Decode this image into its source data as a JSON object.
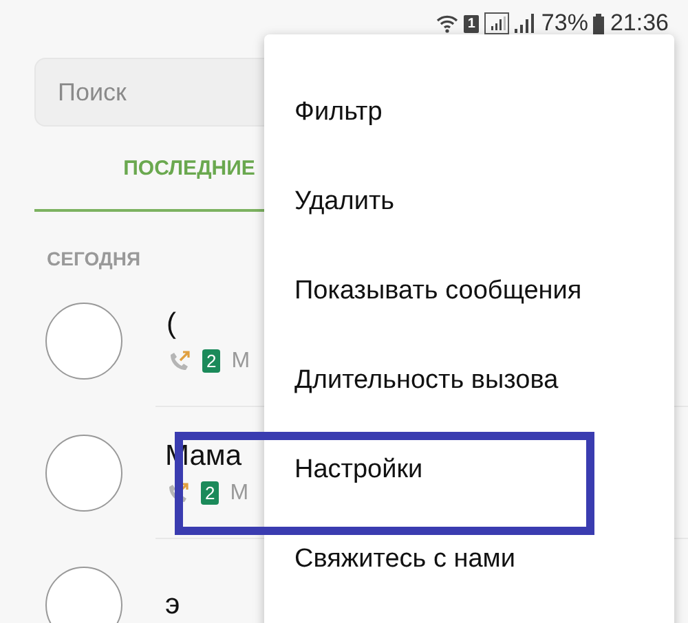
{
  "status_bar": {
    "sim_slot": "1",
    "battery_percent": "73%",
    "time": "21:36"
  },
  "search": {
    "placeholder": "Поиск"
  },
  "tabs": [
    {
      "label": "ПОСЛЕДНИЕ",
      "selected": true
    }
  ],
  "section": "СЕГОДНЯ",
  "calls": [
    {
      "name": "(",
      "sim": "2",
      "detail": "М"
    },
    {
      "name": "Мама",
      "sim": "2",
      "detail": "М"
    },
    {
      "name": "э"
    }
  ],
  "menu": {
    "items": [
      {
        "label": "Фильтр",
        "framed": false
      },
      {
        "label": "Удалить",
        "framed": false
      },
      {
        "label": "Показывать сообщения",
        "framed": false
      },
      {
        "label": "Длительность вызова",
        "framed": false
      },
      {
        "label": "Настройки",
        "framed": true
      },
      {
        "label": "Свяжитесь с нами",
        "framed": false
      }
    ]
  }
}
